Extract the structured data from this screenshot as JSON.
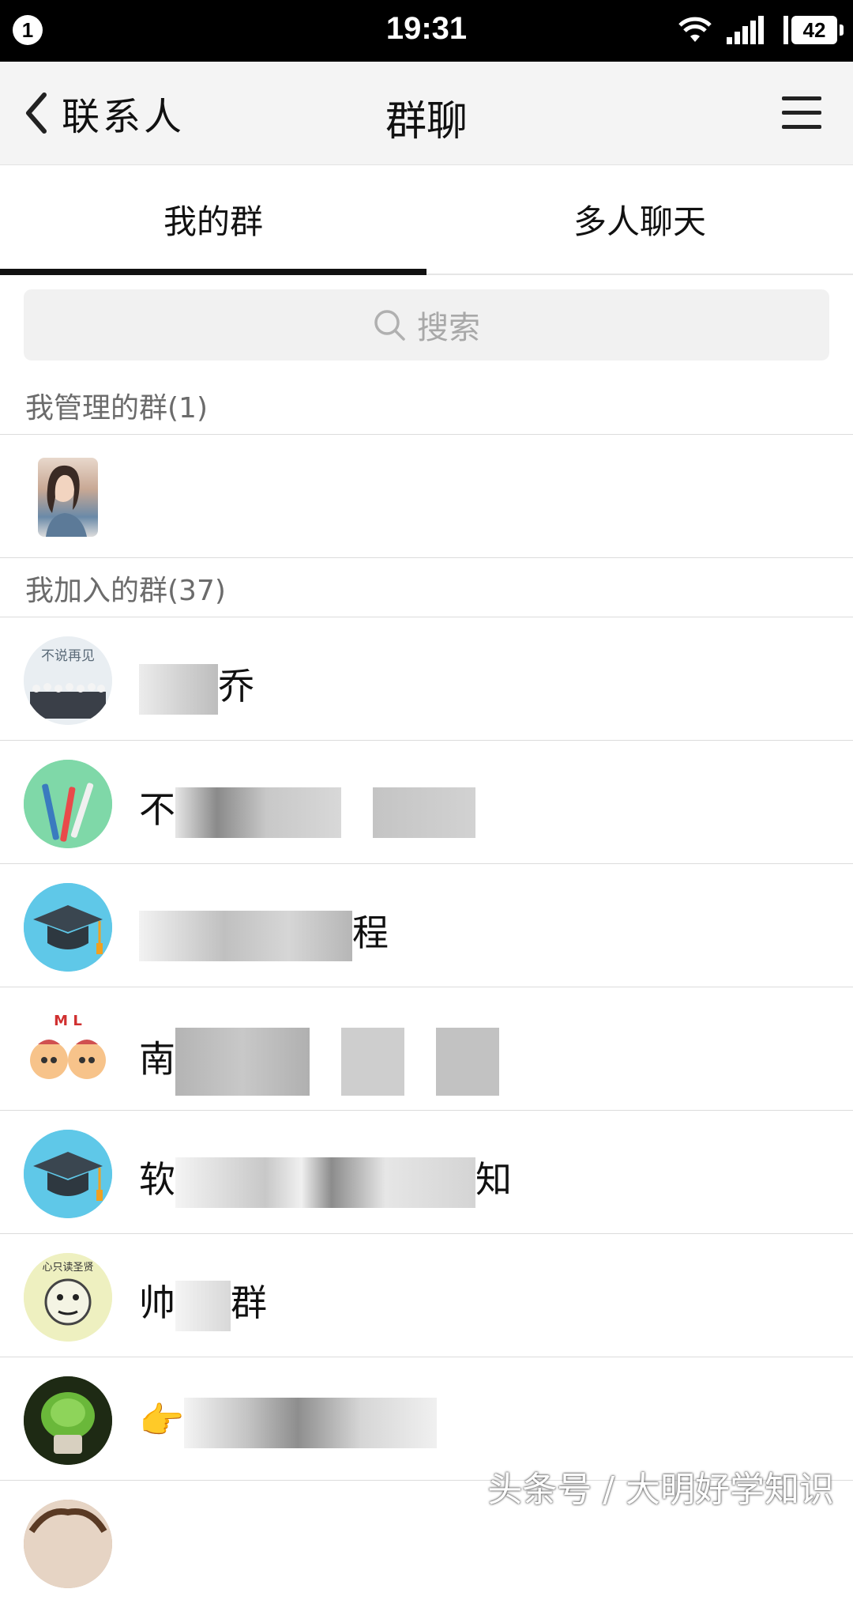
{
  "status_bar": {
    "notification_count": "1",
    "time": "19:31",
    "battery": "42"
  },
  "header": {
    "back_label": "联系人",
    "title": "群聊"
  },
  "tabs": [
    {
      "label": "我的群",
      "active": true
    },
    {
      "label": "多人聊天",
      "active": false
    }
  ],
  "search": {
    "placeholder": "搜索"
  },
  "managed_section": {
    "title": "我管理的群(1)"
  },
  "joined_section": {
    "title": "我加入的群(37)"
  },
  "avatar_texts": {
    "movie": "不说再见",
    "seal": "心只读圣贤",
    "mlm": "M L"
  },
  "groups": [
    {
      "name_visible": "乔"
    },
    {
      "name_visible": "不"
    },
    {
      "name_visible": "程"
    },
    {
      "name_visible": "南"
    },
    {
      "name_visible": "软",
      "name_end": "知"
    },
    {
      "name_visible": "帅",
      "name_end": "群"
    },
    {
      "name_visible": "👉"
    }
  ],
  "watermark": "头条号 / 大明好学知识",
  "colors": {
    "accent": "#111111",
    "header_bg": "#f4f4f4",
    "status_bar": "#000000",
    "grad_cap_bg": "#5fc8e8",
    "brush_bg": "#7fd8a8"
  }
}
